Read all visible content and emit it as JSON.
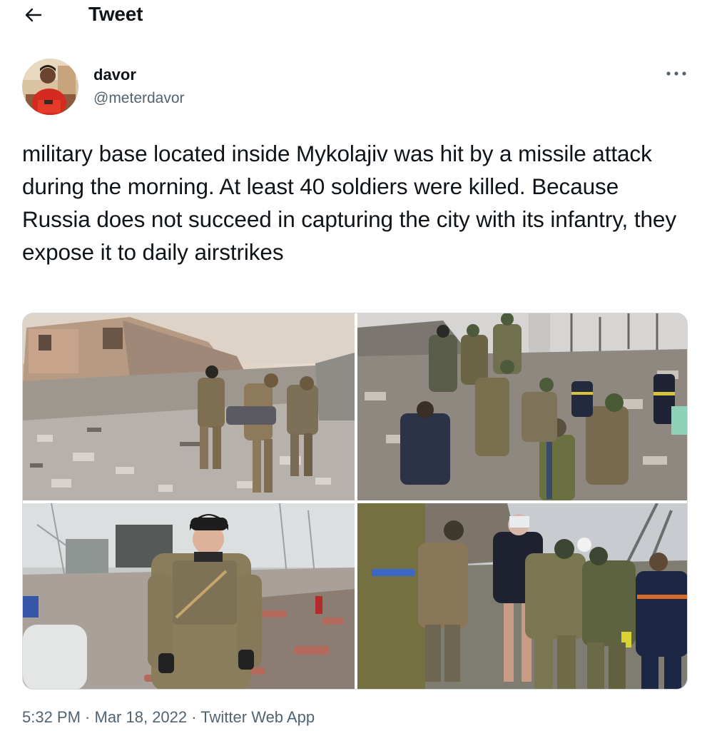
{
  "header": {
    "title": "Tweet",
    "back_icon": "arrow-left-icon"
  },
  "author": {
    "display_name": "davor",
    "handle": "@meterdavor",
    "more_icon": "more-horizontal-icon"
  },
  "tweet": {
    "text": "military base located inside Mykolajiv was hit by a missile attack during the morning. At least 40 soldiers were killed. Because Russia does not succeed in capturing the city with its infantry, they expose it to daily airstrikes",
    "media_count": 4
  },
  "meta": {
    "time": "5:32 PM",
    "separator": " · ",
    "date": "Mar 18, 2022",
    "source": "Twitter Web App"
  },
  "colors": {
    "text_primary": "#0f1419",
    "text_secondary": "#536471",
    "border": "#cfd9de",
    "background": "#ffffff"
  }
}
